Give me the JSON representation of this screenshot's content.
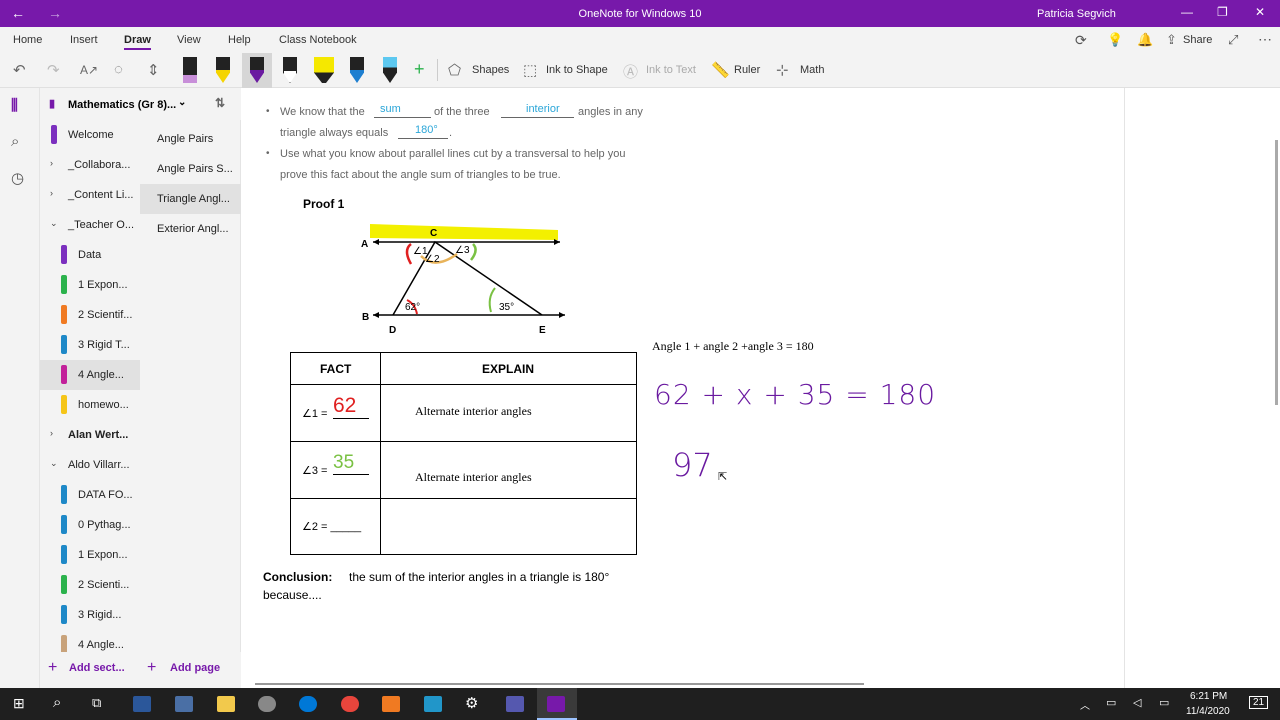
{
  "window": {
    "title": "OneNote for Windows 10",
    "user": "Patricia Segvich"
  },
  "menu": [
    "Home",
    "Insert",
    "Draw",
    "View",
    "Help",
    "Class Notebook"
  ],
  "toolbar": {
    "shapes": "Shapes",
    "ink_to_shape": "Ink to Shape",
    "ink_to_text": "Ink to Text",
    "ruler": "Ruler",
    "math": "Math",
    "share": "Share"
  },
  "notebook": {
    "name": "Mathematics (Gr 8)..."
  },
  "sections": [
    {
      "label": "Welcome",
      "color": "#7b2fbe",
      "indent": 1
    },
    {
      "label": "_Collabora...",
      "chev": "›",
      "indent": 0
    },
    {
      "label": "_Content Li...",
      "chev": "›",
      "indent": 0
    },
    {
      "label": "_Teacher O...",
      "chev": "⌄",
      "indent": 0
    },
    {
      "label": "Data",
      "color": "#7b2fbe",
      "indent": 2
    },
    {
      "label": "1 Expon...",
      "color": "#2bb24c",
      "indent": 2
    },
    {
      "label": "2 Scientif...",
      "color": "#f07a22",
      "indent": 2
    },
    {
      "label": "3 Rigid T...",
      "color": "#1e88c7",
      "indent": 2
    },
    {
      "label": "4 Angle...",
      "color": "#c2209a",
      "indent": 2
    },
    {
      "label": "homewo...",
      "color": "#f5c518",
      "indent": 2
    },
    {
      "label": "Alan Wert...",
      "chev": "›",
      "indent": 0,
      "bold": true
    },
    {
      "label": "Aldo Villarr...",
      "chev": "⌄",
      "indent": 0
    },
    {
      "label": "DATA FO...",
      "color": "#1e88c7",
      "indent": 2
    },
    {
      "label": "0 Pythag...",
      "color": "#1e88c7",
      "indent": 2
    },
    {
      "label": "1 Expon...",
      "color": "#1e88c7",
      "indent": 2
    },
    {
      "label": "2 Scienti...",
      "color": "#2bb24c",
      "indent": 2
    },
    {
      "label": "3 Rigid...",
      "color": "#1e88c7",
      "indent": 2
    },
    {
      "label": "4 Angle...",
      "color": "#c8a27a",
      "indent": 2
    }
  ],
  "pages": [
    "Angle Pairs",
    "Angle Pairs S...",
    "Triangle Angl...",
    "Exterior Angl..."
  ],
  "bottom": {
    "add_section": "Add sect...",
    "add_page": "Add page"
  },
  "content": {
    "bullet1_a": "We know that the",
    "blank_sum": "sum",
    "bullet1_b": "of the three",
    "blank_interior": "interior",
    "bullet1_c": "angles in any",
    "bullet1_d": "triangle always equals",
    "blank_180": "180°",
    "bullet2_a": "Use what you know about parallel lines cut by a transversal to help you",
    "bullet2_b": "prove this fact about the angle sum of triangles to be true.",
    "proof": "Proof 1",
    "diag": {
      "A": "A",
      "B": "B",
      "C": "C",
      "D": "D",
      "E": "E",
      "a1": "∠1",
      "a2": "∠2",
      "a3": "∠3",
      "a62": "62°",
      "a35": "35°"
    },
    "table": {
      "h1": "FACT",
      "h2": "EXPLAIN",
      "r1_fact": "∠1 =",
      "r1_val": "62",
      "r1_exp": "Alternate interior angles",
      "r2_fact": "∠3 =",
      "r2_val": "35",
      "r2_exp": "Alternate interior angles",
      "r3_fact": "∠2 = _____"
    },
    "conclusion_label": "Conclusion:",
    "conclusion_text": "the sum of the interior angles in a triangle is 180°",
    "conclusion_text2": "because....",
    "equation": "Angle 1 + angle 2 +angle 3 =  180",
    "hand1": "62 + x + 35 = 180",
    "hand2": "97"
  },
  "taskbar": {
    "time": "6:21 PM",
    "date": "11/4/2020",
    "notif": "21"
  }
}
